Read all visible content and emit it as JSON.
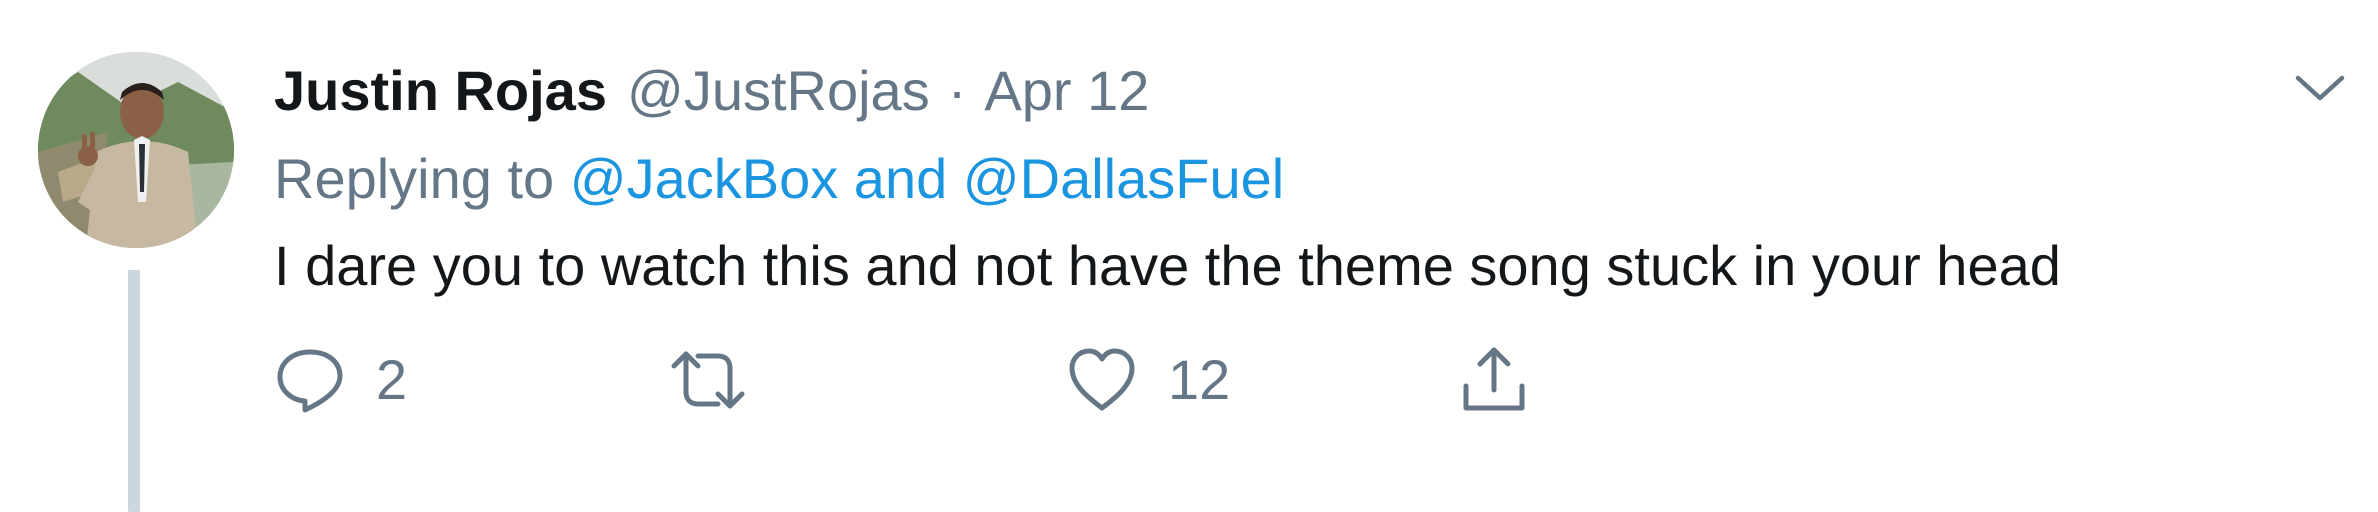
{
  "tweet": {
    "author_name": "Justin Rojas",
    "handle": "@JustRojas",
    "separator": "·",
    "date": "Apr 12",
    "replying_prefix": "Replying to",
    "reply_to_1": "@JackBox",
    "reply_conjunction": "and",
    "reply_to_2": "@DallasFuel",
    "text": "I dare you to watch this and not have the theme song stuck in your head"
  },
  "actions": {
    "reply_count": "2",
    "retweet_count": "",
    "like_count": "12"
  },
  "icons": {
    "reply": "reply-icon",
    "retweet": "retweet-icon",
    "like": "like-icon",
    "share": "share-icon",
    "menu": "chevron-down-icon"
  },
  "colors": {
    "text_primary": "#14171a",
    "text_secondary": "#657786",
    "link": "#1b95e0",
    "thread_line": "#ccd6dd"
  }
}
